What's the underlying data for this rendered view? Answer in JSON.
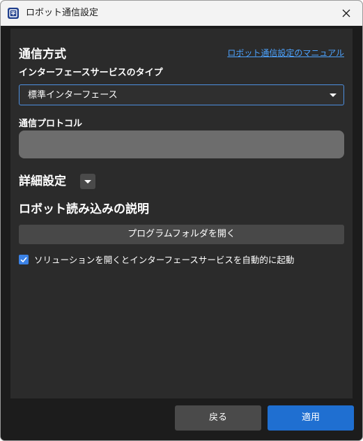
{
  "window": {
    "title": "ロボット通信設定",
    "icon": "app-logo-icon",
    "close_icon": "close-icon"
  },
  "communication": {
    "heading": "通信方式",
    "manual_link": "ロボット通信設定のマニュアル",
    "interface_type_label": "インターフェースサービスのタイプ",
    "interface_type_value": "標準インターフェース",
    "protocol_label": "通信プロトコル",
    "protocol_value": ""
  },
  "advanced": {
    "heading": "詳細設定",
    "toggle_icon": "caret-down-icon"
  },
  "robot_loading": {
    "heading": "ロボット読み込みの説明",
    "open_folder_button": "プログラムフォルダを開く",
    "autostart_checkbox_label": "ソリューションを開くとインターフェースサービスを自動的に起動",
    "autostart_checked": true
  },
  "footer": {
    "back_button": "戻る",
    "apply_button": "適用"
  },
  "colors": {
    "accent": "#1f6fd1",
    "link": "#4da3ff",
    "panel": "#2b2b2b",
    "frame": "#1c1c1c",
    "titlebar": "#f3f3f3"
  }
}
